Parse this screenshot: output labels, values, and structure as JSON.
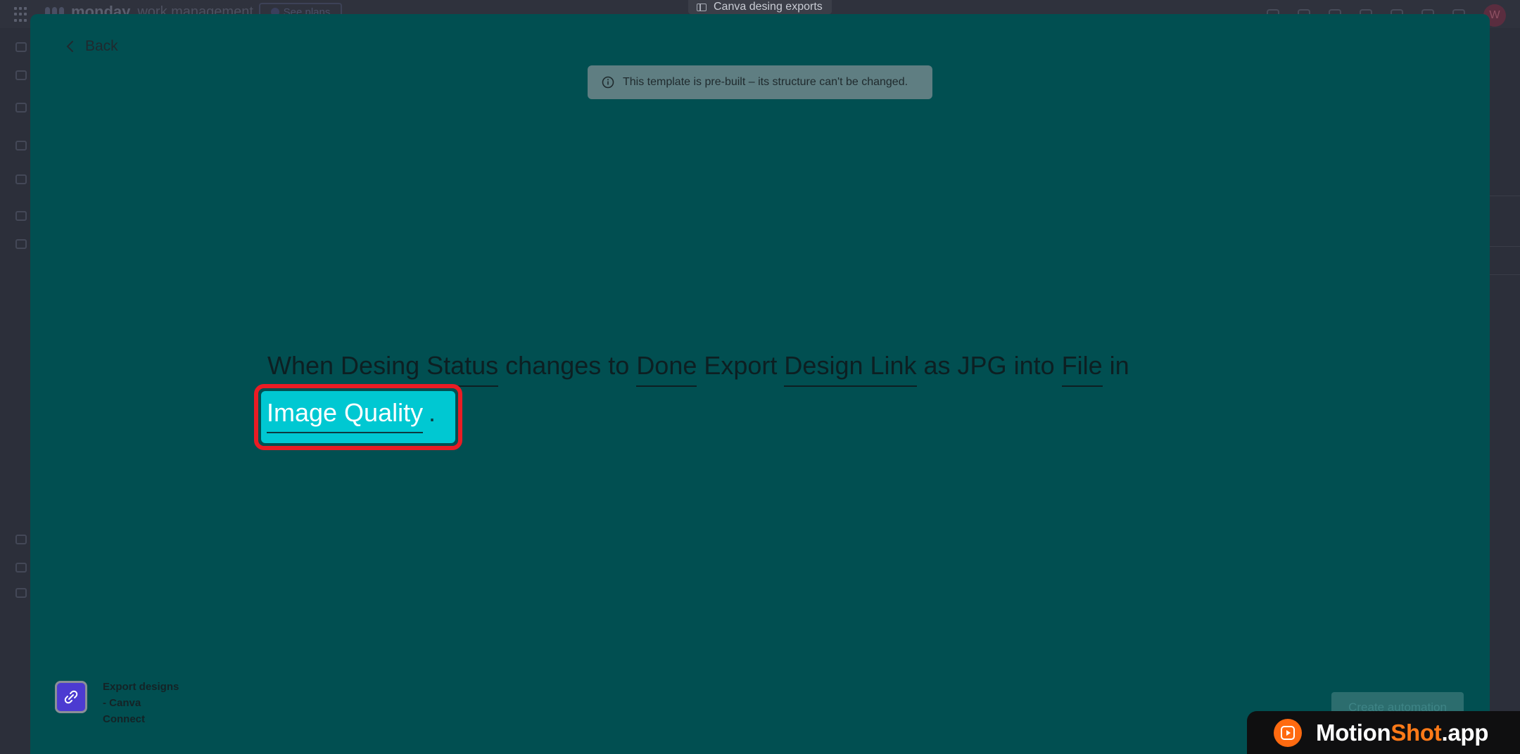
{
  "background_app": {
    "logo_text": "monday",
    "logo_subtitle": "work management",
    "see_plans_label": "See plans",
    "board_tab_title": "Canva desing exports",
    "avatar_initial": "W"
  },
  "modal": {
    "back_label": "Back",
    "banner_text": "This template is pre-built – its structure can't be changed.",
    "recipe": {
      "t1": "When",
      "f1": "Desing Status",
      "t2": "changes to",
      "f2": "Done",
      "t3": "Export",
      "f3": "Design Link",
      "t4": "as JPG into",
      "f4": "File",
      "t5": "in",
      "highlighted_field": "Image Quality",
      "end": "."
    },
    "app": {
      "line1": "Export designs",
      "line2": "- Canva",
      "line3": "Connect"
    },
    "create_button_label": "Create automation"
  },
  "watermark": {
    "brand_a": "Motion",
    "brand_b": "Shot",
    "brand_c": ".app"
  },
  "colors": {
    "modal_bg": "#014f51",
    "highlight_bg": "#00c8d2",
    "highlight_border": "#ea1c24",
    "watermark_accent": "#ff7a18"
  }
}
